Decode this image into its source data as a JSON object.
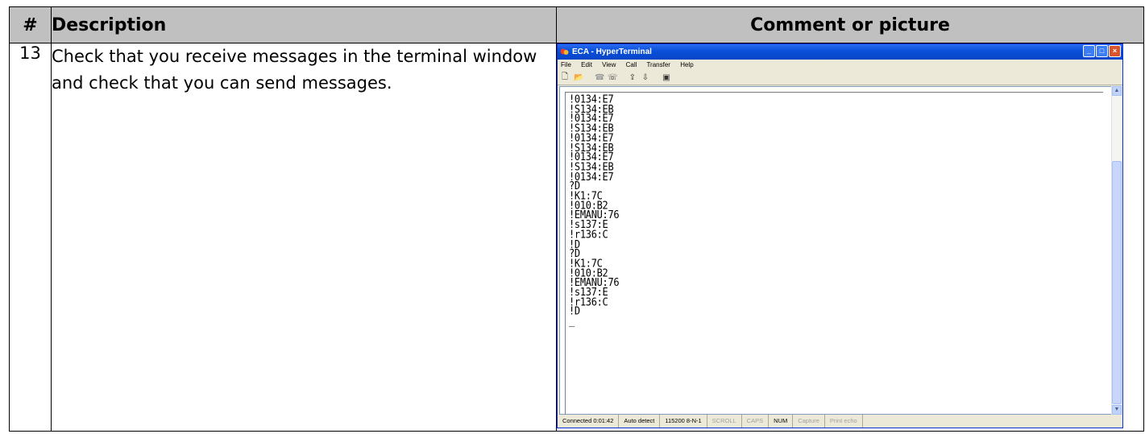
{
  "table": {
    "headers": {
      "num": "#",
      "description": "Description",
      "comment": "Comment or picture"
    },
    "row": {
      "num": "13",
      "description": "Check that you receive messages in the terminal window and check that you can send messages."
    }
  },
  "hyperterminal": {
    "title": "ECA - HyperTerminal",
    "menu": [
      "File",
      "Edit",
      "View",
      "Call",
      "Transfer",
      "Help"
    ],
    "terminal_lines": [
      "!0134:E7",
      "!S134:EB",
      "!0134:E7",
      "!S134:EB",
      "!0134:E7",
      "!S134:EB",
      "!0134:E7",
      "!S134:EB",
      "!0134:E7",
      "?D",
      "!K1:7C",
      "!010:B2",
      "!EMANU:76",
      "!s137:E",
      "!r136:C",
      "!D",
      "?D",
      "!K1:7C",
      "!010:B2",
      "!EMANU:76",
      "!s137:E",
      "!r136:C",
      "!D",
      "_"
    ],
    "status": {
      "connected": "Connected 0:01:42",
      "detect": "Auto detect",
      "settings": "115200 8-N-1",
      "scroll": "SCROLL",
      "caps": "CAPS",
      "num": "NUM",
      "capture": "Capture",
      "print_echo": "Print echo"
    }
  }
}
